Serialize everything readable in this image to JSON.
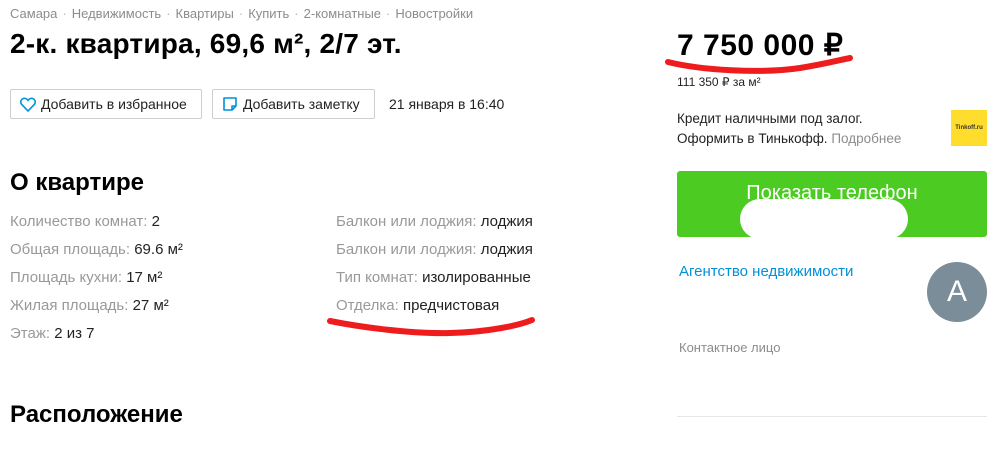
{
  "breadcrumbs": [
    "Самара",
    "Недвижимость",
    "Квартиры",
    "Купить",
    "2-комнатные",
    "Новостройки"
  ],
  "title": "2-к. квартира, 69,6 м², 2/7 эт.",
  "actions": {
    "favorite_label": "Добавить в избранное",
    "note_label": "Добавить заметку",
    "date": "21 января в 16:40"
  },
  "about": {
    "title": "О квартире",
    "left": [
      {
        "key": "Количество комнат:",
        "value": "2"
      },
      {
        "key": "Общая площадь:",
        "value": "69.6 м²"
      },
      {
        "key": "Площадь кухни:",
        "value": "17 м²"
      },
      {
        "key": "Жилая площадь:",
        "value": "27 м²"
      },
      {
        "key": "Этаж:",
        "value": "2 из 7"
      }
    ],
    "right": [
      {
        "key": "Балкон или лоджия:",
        "value": "лоджия"
      },
      {
        "key": "Балкон или лоджия:",
        "value": "лоджия"
      },
      {
        "key": "Тип комнат:",
        "value": "изолированные"
      },
      {
        "key": "Отделка:",
        "value": "предчистовая"
      }
    ]
  },
  "location": {
    "title": "Расположение"
  },
  "sidebar": {
    "price": "7 750 000 ₽",
    "price_per_m2": "111 350 ₽ за м²",
    "credit_line1": "Кредит наличными под залог.",
    "credit_line2": "Оформить в Тинькофф.",
    "credit_more": "Подробнее",
    "tinkoff_logo_text": "Tinkoff.ru",
    "show_phone_label": "Показать телефон",
    "agency": "Агентство недвижимости",
    "avatar_letter": "А",
    "contact_label": "Контактное лицо"
  },
  "colors": {
    "accent_green": "#4ccb23",
    "link_blue": "#0091d9",
    "annotation_red": "#ee1c1c",
    "tinkoff_yellow": "#ffdd2d"
  }
}
